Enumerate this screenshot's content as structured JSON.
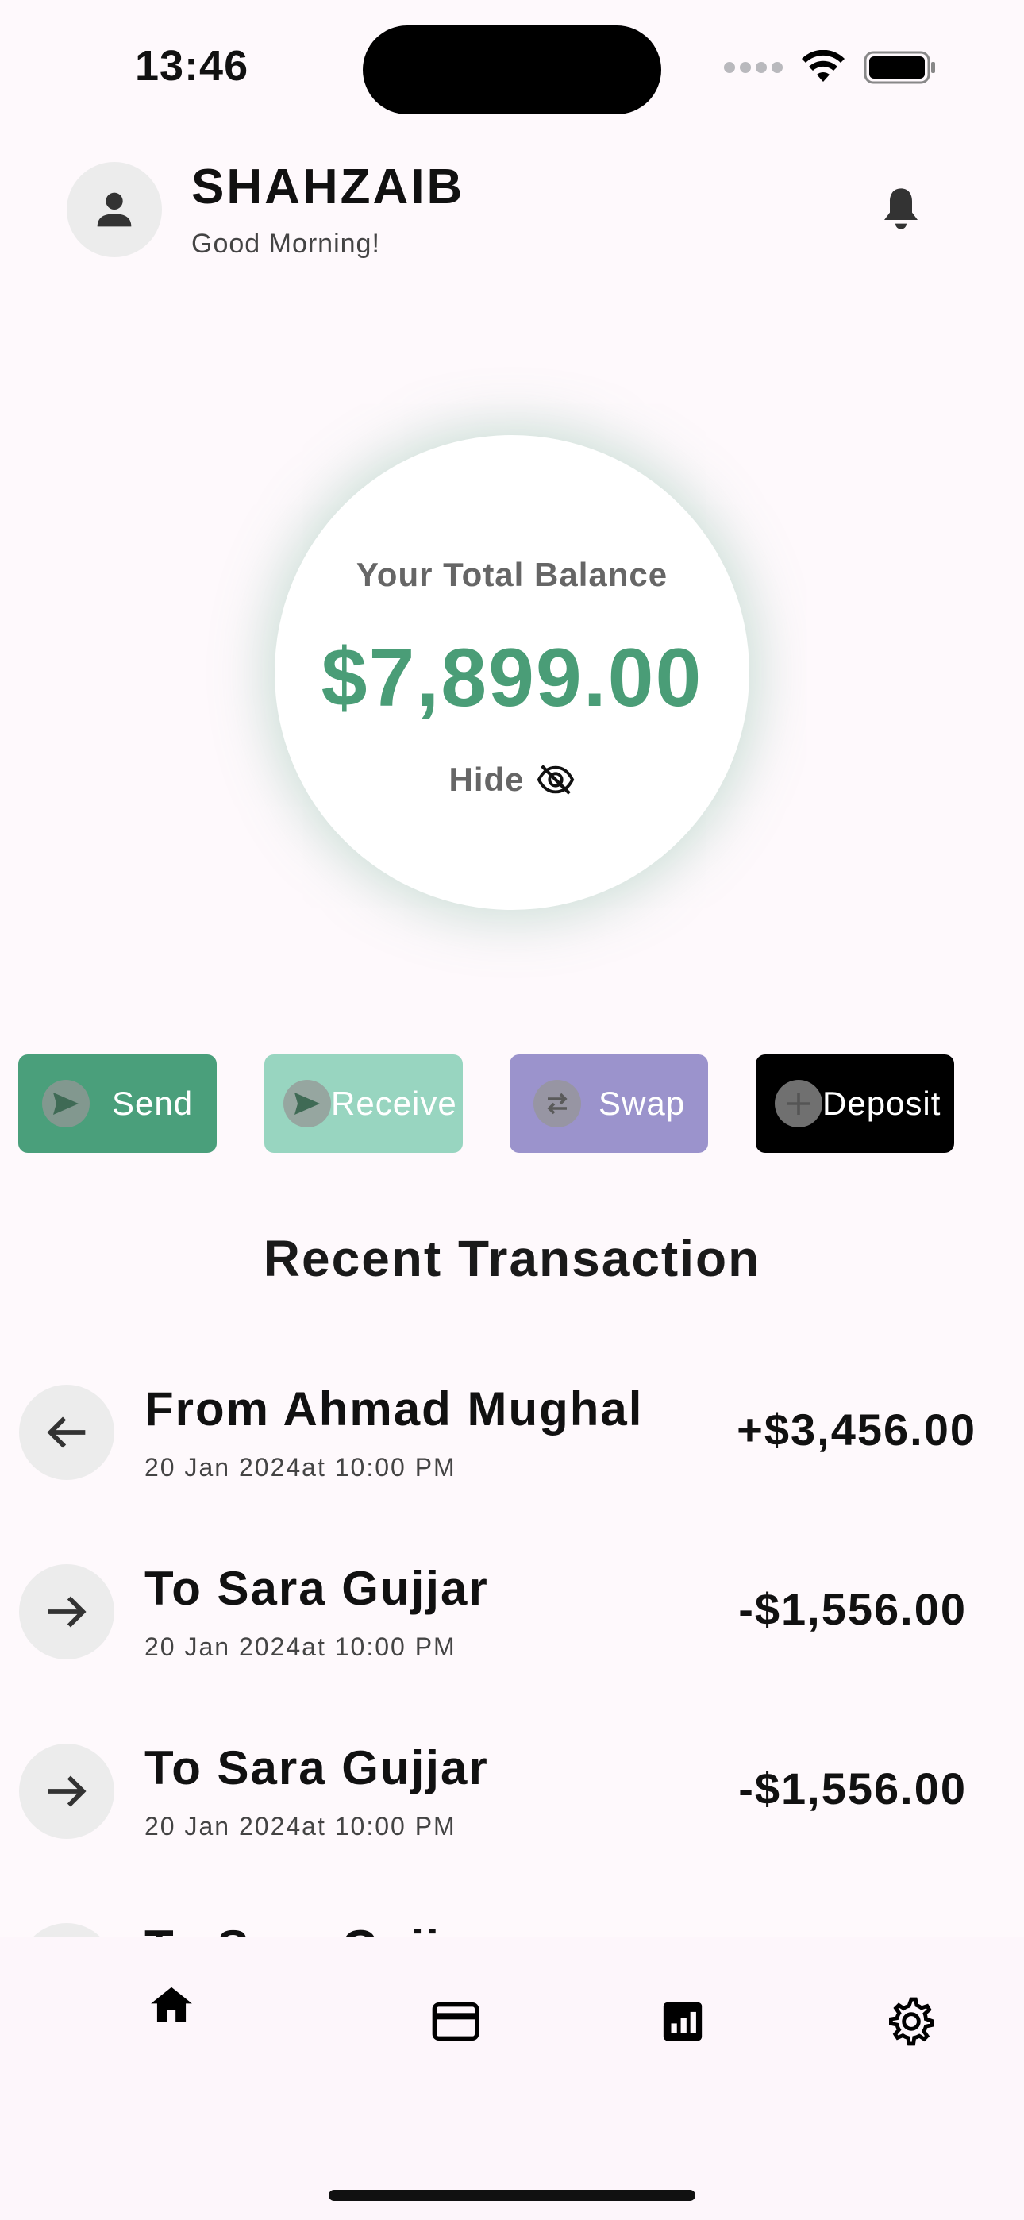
{
  "status_bar": {
    "time": "13:46"
  },
  "header": {
    "username": "SHAHZAIB",
    "greeting": "Good Morning!"
  },
  "balance": {
    "label": "Your Total Balance",
    "amount": "$7,899.00",
    "hide_label": "Hide"
  },
  "actions": [
    {
      "label": "Send",
      "color": "#4a9f7b"
    },
    {
      "label": "Receive",
      "color": "#98d5c0"
    },
    {
      "label": "Swap",
      "color": "#9b93cc"
    },
    {
      "label": "Deposit",
      "color": "#000000"
    }
  ],
  "section_title": "Recent Transaction",
  "transactions": [
    {
      "name": "From Ahmad Mughal",
      "date": "20 Jan 2024at 10:00 PM",
      "amount": "+$3,456.00",
      "direction": "incoming"
    },
    {
      "name": "To Sara Gujjar",
      "date": "20 Jan 2024at 10:00 PM",
      "amount": "-$1,556.00",
      "direction": "outgoing"
    },
    {
      "name": "To Sara Gujjar",
      "date": "20 Jan 2024at 10:00 PM",
      "amount": "-$1,556.00",
      "direction": "outgoing"
    },
    {
      "name": "To Sara Gujjar",
      "date": "",
      "amount": "",
      "direction": "outgoing"
    }
  ],
  "bottom_nav": [
    {
      "icon": "home-icon",
      "active": true
    },
    {
      "icon": "card-icon",
      "active": false
    },
    {
      "icon": "chart-icon",
      "active": false
    },
    {
      "icon": "gear-icon",
      "active": false
    }
  ],
  "colors": {
    "accent": "#4a9d77",
    "background": "#fef9fc"
  }
}
